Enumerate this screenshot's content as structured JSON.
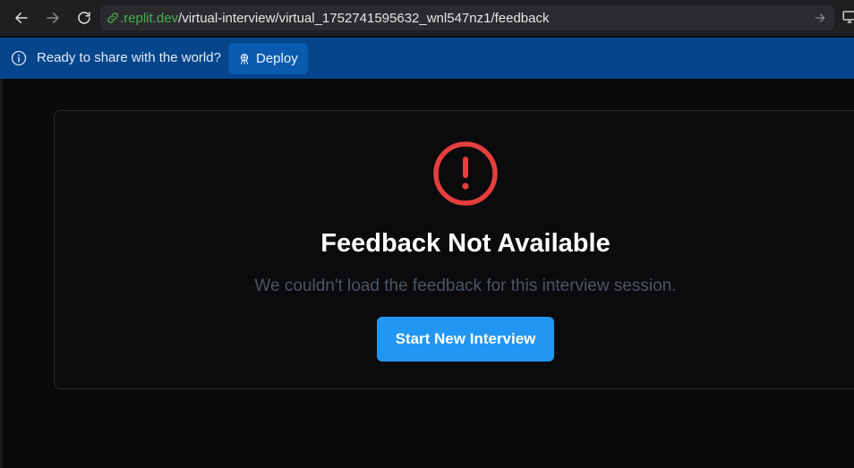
{
  "browser": {
    "url_host": ".replit.dev",
    "url_path": "/virtual-interview/virtual_1752741595632_wnl547nz1/feedback"
  },
  "banner": {
    "text": "Ready to share with the world?",
    "deploy_label": "Deploy",
    "background": "#04458c"
  },
  "feedback": {
    "title": "Feedback Not Available",
    "message": "We couldn't load the feedback for this interview session.",
    "button_label": "Start New Interview",
    "icon": "alert-circle-icon",
    "accent": "#2196f3",
    "error_color": "#e53e3e"
  }
}
